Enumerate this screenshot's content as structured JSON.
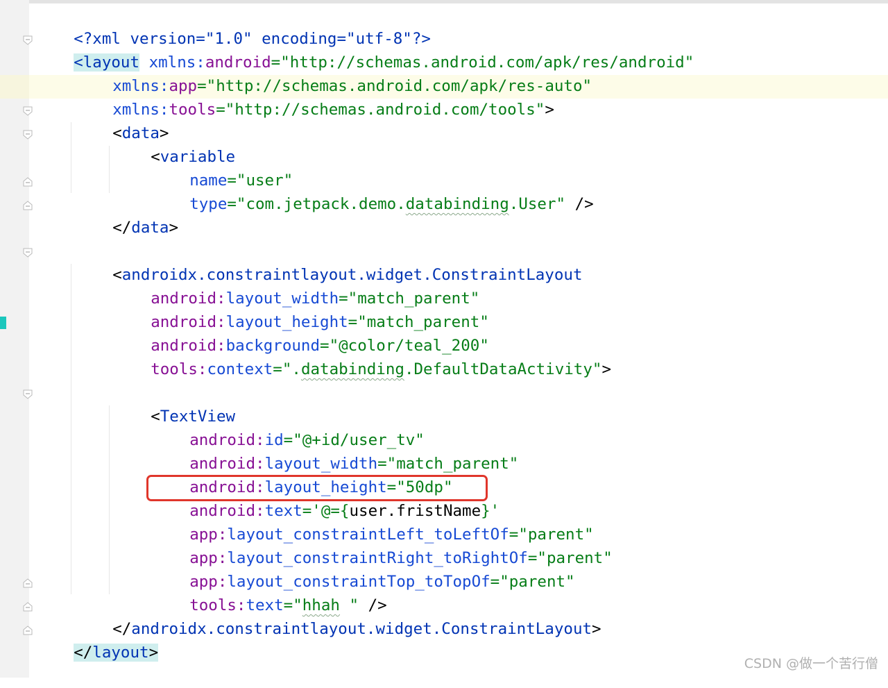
{
  "editor": {
    "lines": [
      {
        "pi": "<?xml version=\"1.0\" encoding=\"utf-8\"?>"
      },
      {
        "open": "<",
        "tag": "layout",
        "ns": "xmlns:",
        "attr": "android",
        "eq": "=",
        "val": "\"http://schemas.android.com/apk/res/android\""
      },
      {
        "ns": "xmlns:",
        "attr": "app",
        "eq": "=",
        "val": "\"http://schemas.android.com/apk/res-auto\""
      },
      {
        "ns": "xmlns:",
        "attr": "tools",
        "eq": "=",
        "val": "\"http://schemas.android.com/tools\"",
        "close": ">"
      },
      {
        "open": "<",
        "tag": "data",
        "close": ">"
      },
      {
        "open": "<",
        "tag": "variable"
      },
      {
        "attr": "name",
        "eq": "=",
        "val": "\"user\""
      },
      {
        "attr": "type",
        "eq": "=",
        "val_a": "\"com.jetpack.demo.",
        "val_b": "databinding",
        "val_c": ".User\"",
        "close": " />"
      },
      {
        "open": "</",
        "tag": "data",
        "close": ">"
      },
      {
        "open": "<",
        "tag": "androidx.constraintlayout.widget.ConstraintLayout"
      },
      {
        "ns": "android:",
        "attr": "layout_width",
        "eq": "=",
        "val": "\"match_parent\""
      },
      {
        "ns": "android:",
        "attr": "layout_height",
        "eq": "=",
        "val": "\"match_parent\""
      },
      {
        "ns": "android:",
        "attr": "background",
        "eq": "=",
        "val": "\"@color/teal_200\""
      },
      {
        "ns": "tools:",
        "attr": "context",
        "eq": "=",
        "val_a": "\".",
        "val_b": "databinding",
        "val_c": ".DefaultDataActivity\"",
        "close": ">"
      },
      {
        "open": "<",
        "tag": "TextView"
      },
      {
        "ns": "android:",
        "attr": "id",
        "eq": "=",
        "val": "\"@+id/user_tv\""
      },
      {
        "ns": "android:",
        "attr": "layout_width",
        "eq": "=",
        "val": "\"match_parent\""
      },
      {
        "ns": "android:",
        "attr": "layout_height",
        "eq": "=",
        "val": "\"50dp\""
      },
      {
        "ns": "android:",
        "attr": "text",
        "eq": "=",
        "val_a": "'@={",
        "val_b": "user.fristName",
        "val_c": "}'"
      },
      {
        "ns": "app:",
        "attr": "layout_constraintLeft_toLeftOf",
        "eq": "=",
        "val": "\"parent\""
      },
      {
        "ns": "app:",
        "attr": "layout_constraintRight_toRightOf",
        "eq": "=",
        "val": "\"parent\""
      },
      {
        "ns": "app:",
        "attr": "layout_constraintTop_toTopOf",
        "eq": "=",
        "val": "\"parent\""
      },
      {
        "ns": "tools:",
        "attr": "text",
        "eq": "=",
        "val_a": "\"",
        "val_b": "hhah",
        "val_c": " \"",
        "close": " />"
      },
      {
        "open": "</",
        "tag": "androidx.constraintlayout.widget.ConstraintLayout",
        "close": ">"
      },
      {
        "open": "</",
        "tag": "layout",
        "close": ">"
      }
    ]
  },
  "watermark": "CSDN @做一个苦行僧",
  "colors": {
    "tag": "#0033b3",
    "namespace": "#871094",
    "attribute": "#174ad4",
    "value": "#067d17",
    "highlight_box": "#e0362b",
    "change_marker": "#1cc7bd"
  }
}
